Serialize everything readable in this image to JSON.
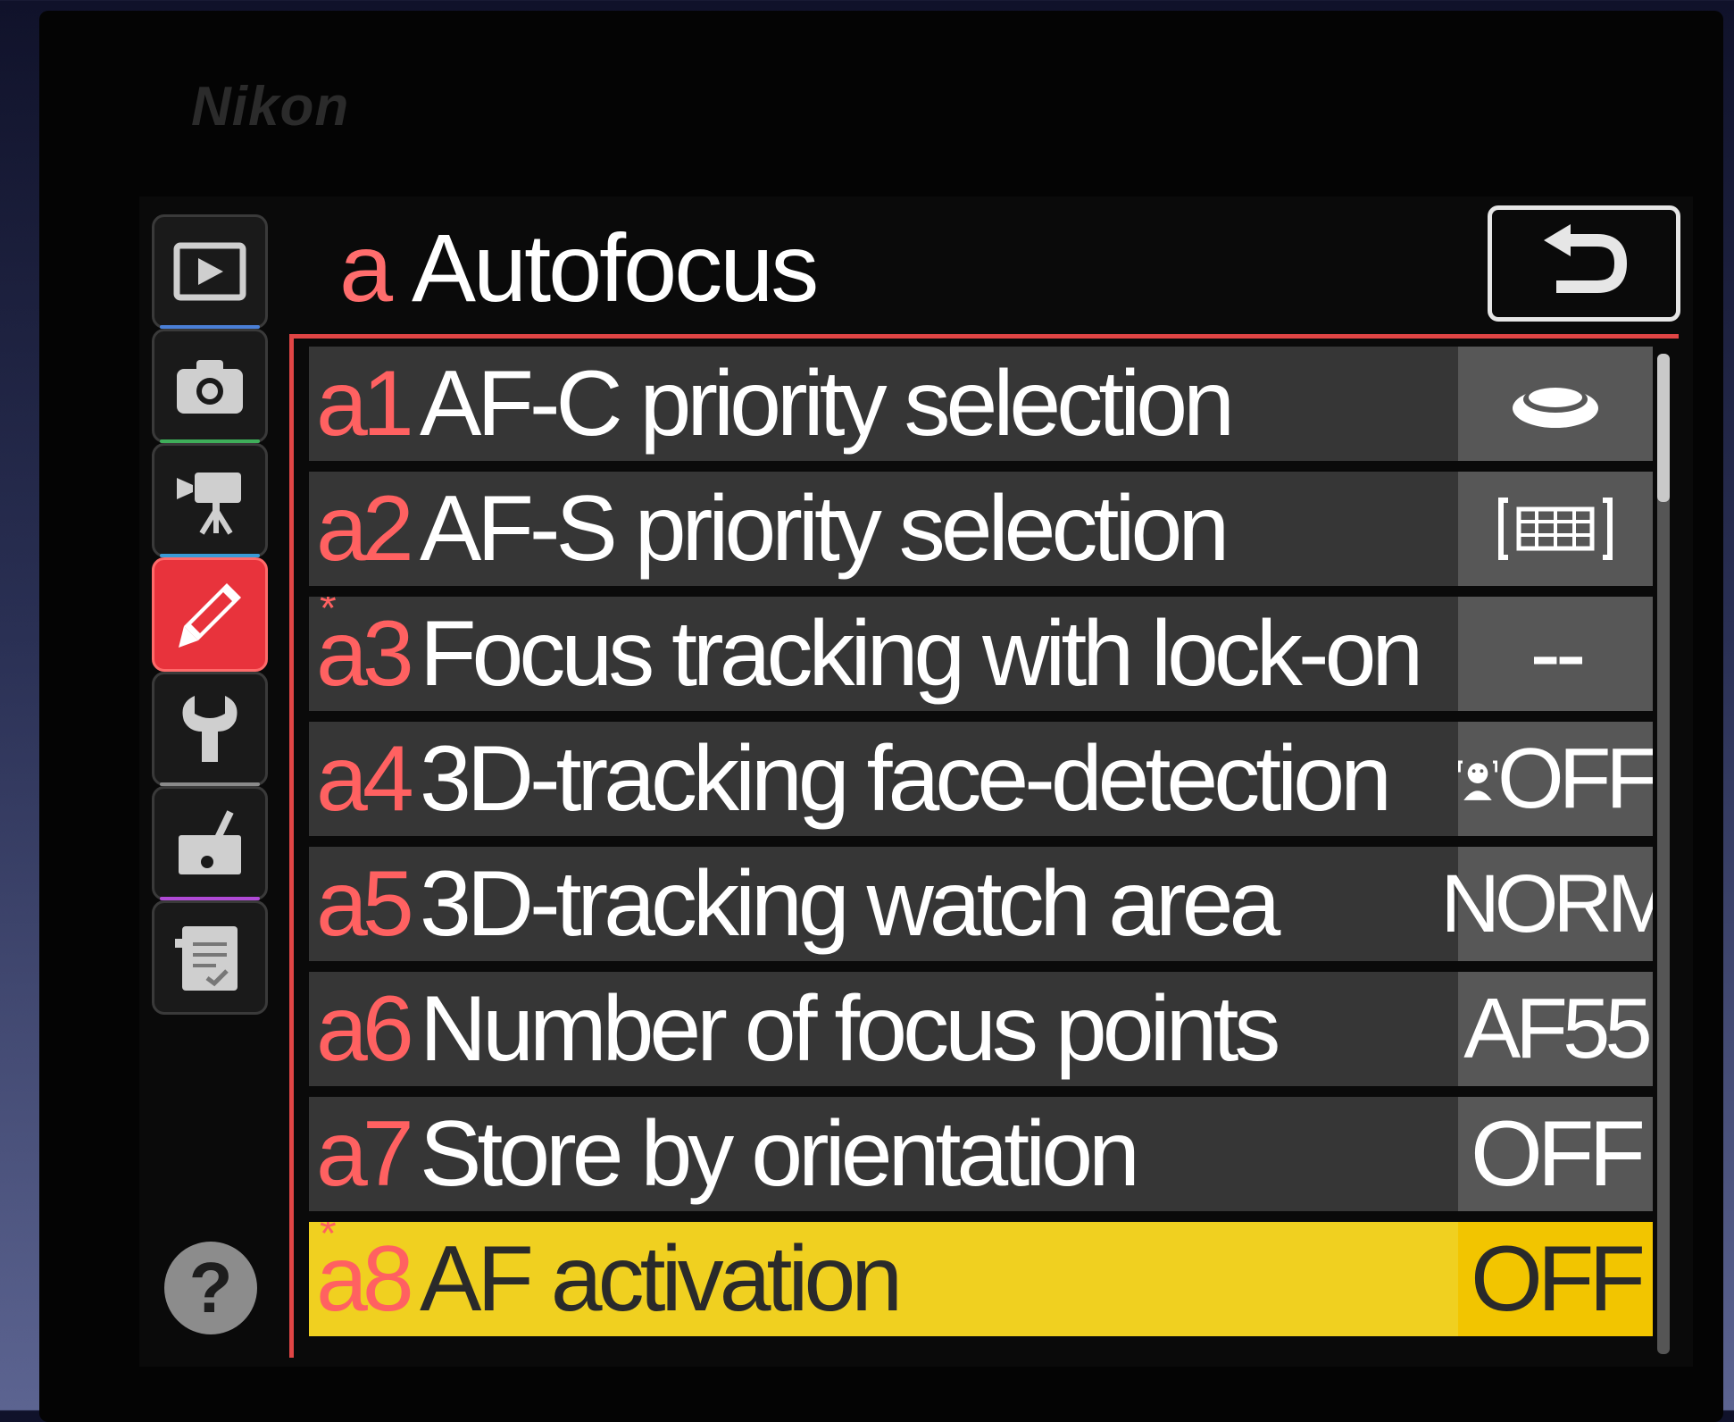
{
  "device": {
    "brand": "Nikon"
  },
  "sidebar": {
    "tabs": [
      {
        "icon": "playback-icon",
        "name": "playback"
      },
      {
        "icon": "camera-icon",
        "name": "photo-shooting"
      },
      {
        "icon": "movie-camera-icon",
        "name": "movie-shooting"
      },
      {
        "icon": "pencil-icon",
        "name": "custom-settings",
        "active": true
      },
      {
        "icon": "wrench-icon",
        "name": "setup"
      },
      {
        "icon": "retouch-icon",
        "name": "retouch"
      },
      {
        "icon": "my-menu-icon",
        "name": "my-menu"
      }
    ],
    "help_label": "?"
  },
  "header": {
    "menu_letter": "a",
    "title": "Autofocus",
    "back_icon": "return-arrow-icon"
  },
  "items": [
    {
      "code": "a1",
      "label": "AF-C priority selection",
      "value": "",
      "value_icon": "release-button-icon"
    },
    {
      "code": "a2",
      "label": "AF-S priority selection",
      "value": "",
      "value_icon": "focus-priority-icon"
    },
    {
      "code": "a3",
      "mark": "*",
      "label": "Focus tracking with lock-on",
      "value": "--"
    },
    {
      "code": "a4",
      "label": "3D-tracking face-detection",
      "value": "OFF",
      "value_icon": "face-detection-icon"
    },
    {
      "code": "a5",
      "label": "3D-tracking watch area",
      "value": "NORM"
    },
    {
      "code": "a6",
      "label": "Number of focus points",
      "value": "AF55"
    },
    {
      "code": "a7",
      "label": "Store by orientation",
      "value": "OFF"
    },
    {
      "code": "a8",
      "mark": "*",
      "label": "AF activation",
      "value": "OFF",
      "selected": true
    }
  ],
  "colors": {
    "accent_red": "#e8333c",
    "highlight_yellow": "#f0d020",
    "row_bg": "#363636"
  }
}
